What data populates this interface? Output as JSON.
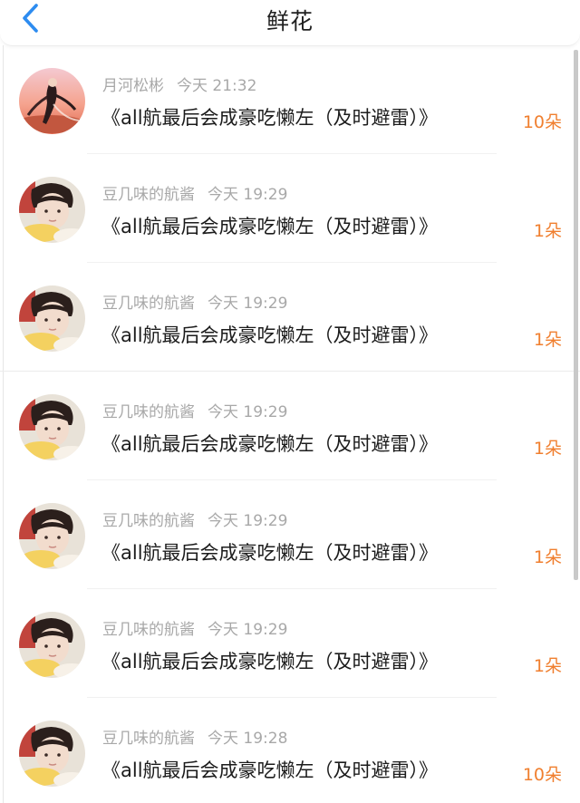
{
  "header": {
    "title": "鲜花",
    "back_icon": "chevron-left-icon",
    "accent_color": "#2d8cf0"
  },
  "colors": {
    "count": "#f07f2f",
    "meta": "#a8a8a8",
    "title": "#1c1c1c"
  },
  "gifts": [
    {
      "user": "月河松彬",
      "time": "今天 21:32",
      "work": "《all航最后会成豪吃懒左（及时避雷）》",
      "count": "10朵",
      "avatar": "avatar-dancer"
    },
    {
      "user": "豆几味的航酱",
      "time": "今天 19:29",
      "work": "《all航最后会成豪吃懒左（及时避雷）》",
      "count": "1朵",
      "avatar": "avatar-boy"
    },
    {
      "user": "豆几味的航酱",
      "time": "今天 19:29",
      "work": "《all航最后会成豪吃懒左（及时避雷）》",
      "count": "1朵",
      "avatar": "avatar-boy"
    },
    {
      "user": "豆几味的航酱",
      "time": "今天 19:29",
      "work": "《all航最后会成豪吃懒左（及时避雷）》",
      "count": "1朵",
      "avatar": "avatar-boy"
    },
    {
      "user": "豆几味的航酱",
      "time": "今天 19:29",
      "work": "《all航最后会成豪吃懒左（及时避雷）》",
      "count": "1朵",
      "avatar": "avatar-boy"
    },
    {
      "user": "豆几味的航酱",
      "time": "今天 19:29",
      "work": "《all航最后会成豪吃懒左（及时避雷）》",
      "count": "1朵",
      "avatar": "avatar-boy"
    },
    {
      "user": "豆几味的航酱",
      "time": "今天 19:28",
      "work": "《all航最后会成豪吃懒左（及时避雷）》",
      "count": "10朵",
      "avatar": "avatar-boy"
    }
  ]
}
